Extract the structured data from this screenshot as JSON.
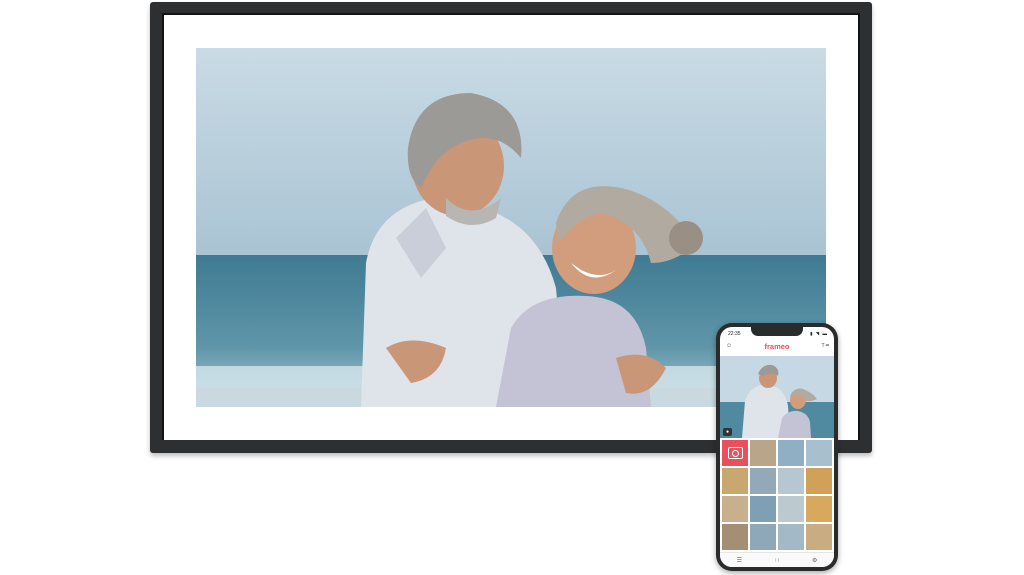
{
  "phone": {
    "status_time": "22:35",
    "status_icons": "▮ ◥ ▬",
    "app_logo": "frameo",
    "header_action": "T·⌗",
    "user_icon": "person-add-icon",
    "nav_icons": [
      "menu-icon",
      "grid-icon",
      "settings-icon"
    ]
  },
  "colors": {
    "frame": "#2e2f31",
    "app_accent": "#e8505b"
  }
}
